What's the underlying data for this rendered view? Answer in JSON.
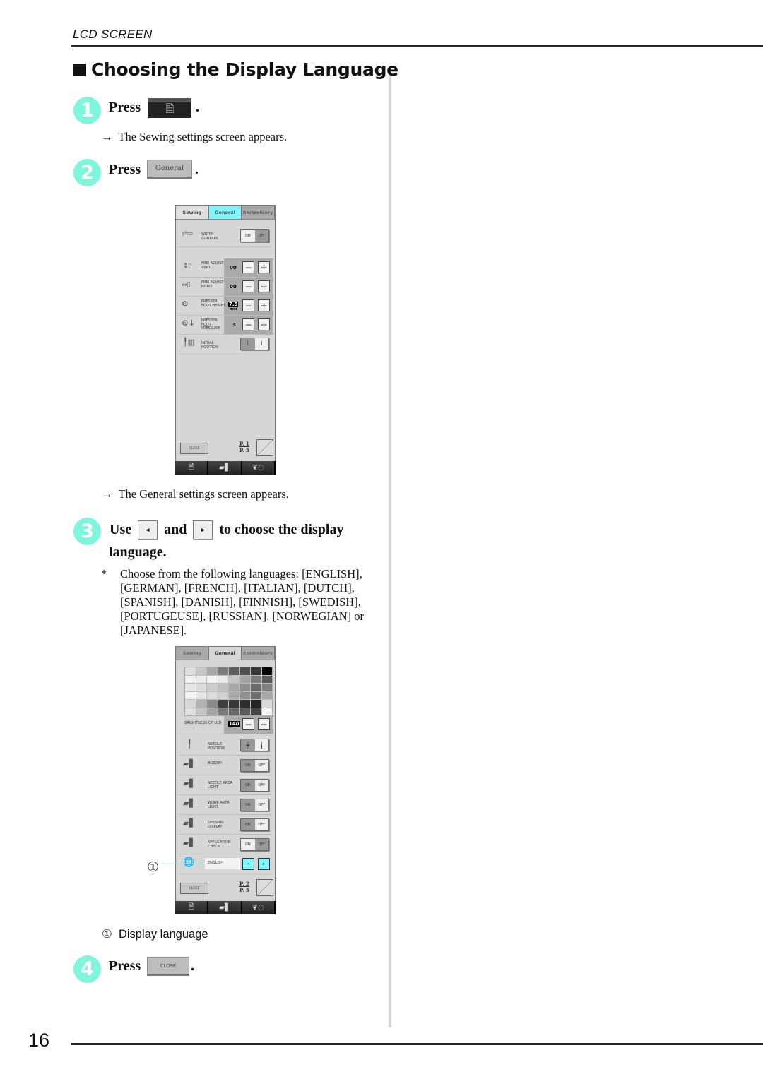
{
  "header": {
    "running_head": "LCD SCREEN",
    "page_number": "16"
  },
  "section": {
    "title": "Choosing the Display Language"
  },
  "steps": [
    {
      "number": "1",
      "text": "Press",
      "button": "sewing-settings-icon",
      "result": "The Sewing settings screen appears."
    },
    {
      "number": "2",
      "text": "Press",
      "button_label": "General",
      "result": "The General settings screen appears."
    },
    {
      "number": "3",
      "text_use": "Use",
      "text_and": "and",
      "text_tail": "to choose the display",
      "text_line2": "language.",
      "left_glyph": "◂",
      "right_glyph": "▸",
      "note_marker": "*",
      "note": "Choose from the following languages: [ENGLISH], [GERMAN], [FRENCH], [ITALIAN], [DUTCH], [SPANISH], [DANISH], [FINNISH], [SWEDISH], [PORTUGEUSE], [RUSSIAN], [NORWEGIAN] or [JAPANESE]."
    },
    {
      "number": "4",
      "text": "Press",
      "button_label": "CLOSE"
    }
  ],
  "arrow": "→",
  "callout": {
    "marker": "①",
    "label": "Display language"
  },
  "colors": {
    "badge": "#7ff5dc",
    "active_tab": "#7ff5ff",
    "arrow_buttons": "#7ff5ff"
  },
  "screen1": {
    "tabs": [
      "Sewing",
      "General",
      "Embroidery"
    ],
    "active_tab": "General",
    "rows": [
      {
        "label": "WIDTH CONTROL",
        "on": "ON",
        "off": "OFF",
        "selected": "OFF"
      },
      {
        "label": "FINE ADJUST VERTI.",
        "value": "00"
      },
      {
        "label": "FINE ADJUST HORIZ.",
        "value": "00"
      },
      {
        "label": "PRESSER FOOT HEIGHT",
        "value": "7.5",
        "unit": "mm"
      },
      {
        "label": "PRESSER FOOT PRESSURE",
        "value": "3"
      },
      {
        "label": "INITIAL POSITION"
      }
    ],
    "minus": "−",
    "plus": "+",
    "close": "CLOSE",
    "page": "P. 1",
    "pages": "P. 5",
    "bottom": [
      "sewing-settings-icon",
      "machine-icon",
      "embroidery-icon"
    ]
  },
  "screen2": {
    "tabs": [
      "Sewing",
      "General",
      "Embroidery"
    ],
    "active_tab": "General",
    "palette": [
      "#dcdcdc",
      "#c8c8c8",
      "#a8a8a8",
      "#7a7a7a",
      "#5e5e5e",
      "#505050",
      "#3a3a3a",
      "#050505",
      "#f0f0f0",
      "#eaeaea",
      "#f2f2f2",
      "#e8e8e8",
      "#c4c4c4",
      "#a4a4a4",
      "#7e7e7e",
      "#5a5a5a",
      "#e6e6e6",
      "#dcdcdc",
      "#cccccc",
      "#c0c0c0",
      "#a8a8a8",
      "#8e8e8e",
      "#6a6a6a",
      "#808080",
      "#f2f2f2",
      "#e6e6e6",
      "#dcdcdc",
      "#d2d2d2",
      "#aaaaaa",
      "#929292",
      "#6e6e6e",
      "#a8a8a8",
      "#d8d8d8",
      "#b2b2b2",
      "#8a8a8a",
      "#3e3e3e",
      "#383838",
      "#2e2e2e",
      "#242424",
      "#dadada",
      "#e0e0e0",
      "#c6c6c6",
      "#a6a6a6",
      "#7c7c7c",
      "#6a6a6a",
      "#5a5a5a",
      "#464646",
      "#f4f4f4"
    ],
    "brightness": {
      "label": "BRIGHTNESS OF LCD",
      "value": "140"
    },
    "needle": "NEEDLE POSITION",
    "toggles": [
      {
        "label": "BUZZER",
        "on": "ON",
        "off": "OFF",
        "selected": "ON"
      },
      {
        "label": "NEEDLE AREA LIGHT",
        "on": "ON",
        "off": "OFF",
        "selected": "ON"
      },
      {
        "label": "WORK AREA LIGHT",
        "on": "ON",
        "off": "OFF",
        "selected": "ON"
      },
      {
        "label": "OPENING DISPLAY",
        "on": "ON",
        "off": "OFF",
        "selected": "ON"
      },
      {
        "label": "APPLICATION CHECK",
        "on": "ON",
        "off": "OFF",
        "selected": "OFF"
      }
    ],
    "language": "ENGLISH",
    "close": "CLOSE",
    "page": "P. 2",
    "pages": "P. 5"
  }
}
